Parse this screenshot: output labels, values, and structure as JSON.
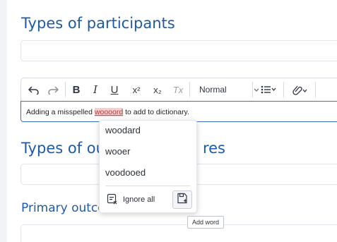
{
  "sections": [
    {
      "heading": "Types of participants"
    },
    {
      "heading": "Types of ou",
      "heading_tail": "res"
    },
    {
      "heading": "Primary outco"
    }
  ],
  "toolbar": {
    "undo": "undo",
    "redo": "redo",
    "bold": "B",
    "italic": "I",
    "underline": "U",
    "superscript": "x²",
    "subscript": "x₂",
    "clear_format": "Tx",
    "format_select": "Normal"
  },
  "editor": {
    "text_before": "Adding a misspelled ",
    "misspelled_word": "woooord",
    "text_after": " to add to dictionary."
  },
  "spell_menu": {
    "suggestions": [
      "woodard",
      "wooer",
      "voodooed"
    ],
    "ignore_all": "Ignore all",
    "add_word_tooltip": "Add word"
  },
  "colors": {
    "heading": "#1f5aa6",
    "focus_border": "#3d6fc8",
    "misspelled_bg": "#f5cfcf"
  },
  "icons": [
    "undo-icon",
    "redo-icon",
    "list-icon",
    "link-icon",
    "ignore-all-icon",
    "add-word-icon"
  ]
}
